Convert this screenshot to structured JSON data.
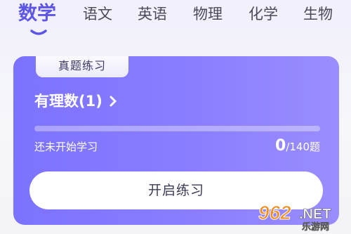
{
  "tabs": [
    {
      "label": "数学",
      "active": true
    },
    {
      "label": "语文",
      "active": false
    },
    {
      "label": "英语",
      "active": false
    },
    {
      "label": "物理",
      "active": false
    },
    {
      "label": "化学",
      "active": false
    },
    {
      "label": "生物",
      "active": false
    }
  ],
  "card": {
    "tag": "真题练习",
    "title": "有理数(1)",
    "chevron_icon": "chevron-right-icon",
    "status": "还未开始学习",
    "progress": 0,
    "count_done": "0",
    "count_total": "/140题",
    "button_label": "开启练习"
  },
  "watermark": {
    "number": "962",
    "suffix": ".NET",
    "site": "乐游网"
  },
  "colors": {
    "accent": "#5d55e6",
    "card_start": "#7b72ff",
    "card_end": "#9a8dff",
    "watermark_orange": "#f28c1e"
  }
}
